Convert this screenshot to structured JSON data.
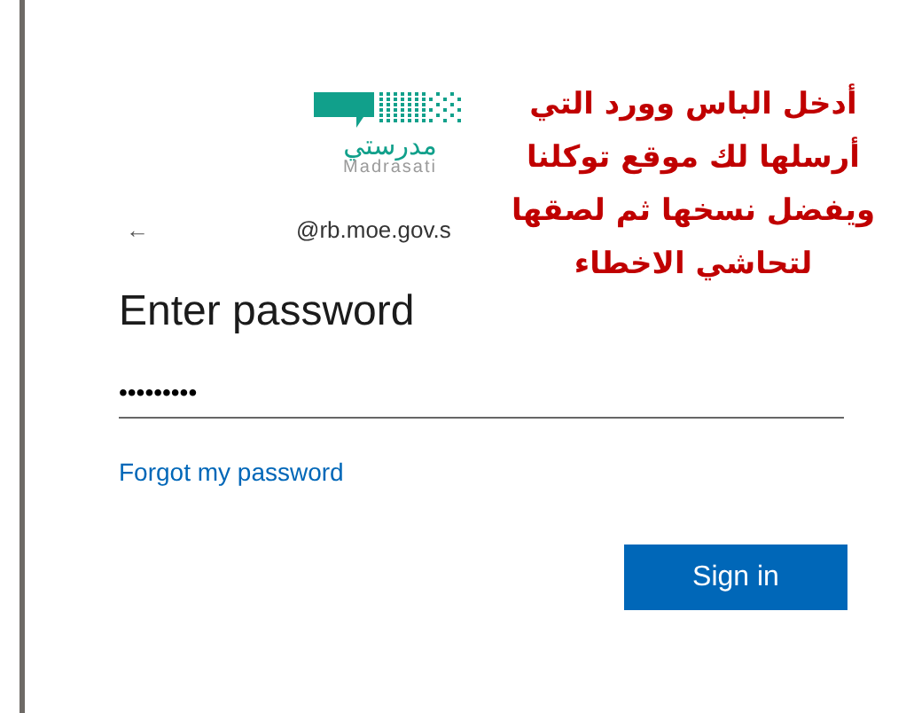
{
  "logo": {
    "arabic": "مدرستي",
    "latin": "Madrasati"
  },
  "account": {
    "back": "←",
    "email": "@rb.moe.gov.s"
  },
  "heading": "Enter password",
  "password": {
    "value": "•••••••••"
  },
  "forgot_link": "Forgot my password",
  "buttons": [
    "Sign in"
  ],
  "annotation": {
    "lines": [
      "أدخل الباس وورد التي",
      "أرسلها لك موقع توكلنا",
      "ويفضل نسخها ثم لصقها",
      "لتحاشي الاخطاء"
    ]
  }
}
